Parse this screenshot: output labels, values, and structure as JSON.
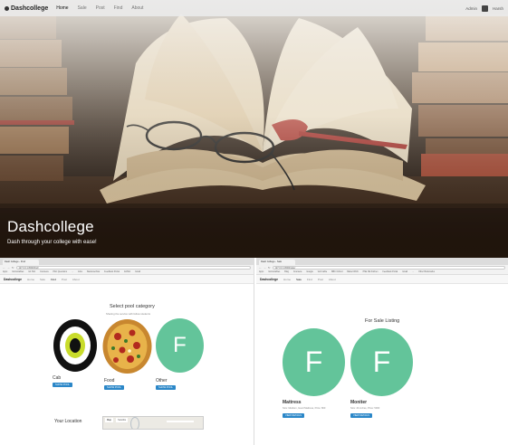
{
  "hero": {
    "brand": "Dashcollege",
    "nav": [
      "Home",
      "Sale",
      "Post",
      "Find",
      "About"
    ],
    "user": {
      "admin_link": "Admin",
      "name": "Harsh"
    },
    "title": "Dashcollege",
    "subtitle": "Dash through your college with ease!"
  },
  "left_panel": {
    "tab_title": "Dash College - Find",
    "url": "127.0.0.1:8000/find/",
    "bookmarks": [
      "Apps",
      "Instructables",
      "Git Hub",
      "Coursera",
      "PAC Questions",
      "...",
      "Jobs",
      "Stackoverflow",
      "Feedback Portal",
      "GitHub",
      "Gmail"
    ],
    "nav_brand": "Dashcollege",
    "nav": [
      "Home",
      "Sale",
      "Find",
      "Post",
      "About"
    ],
    "heading": "Select pool category",
    "subheading": "Sharing the service with fellow students",
    "categories": [
      {
        "label": "Cab",
        "button": "SHOW POOL",
        "icon": "cab-logo-icon"
      },
      {
        "label": "Food",
        "button": "SHOW POOL",
        "icon": "pizza-icon"
      },
      {
        "label": "Other",
        "button": "SHOW POOL",
        "letter": "F"
      }
    ],
    "location_label": "Your Location",
    "map_tabs": [
      "Map",
      "Satellite"
    ]
  },
  "right_panel": {
    "tab_title": "Dash College - Sale",
    "url": "127.0.0.1:8000/sale/",
    "bookmarks": [
      "Apps",
      "Instructables",
      "Blog",
      "Coursera",
      "Google",
      "Verb table",
      "BBC Oxford",
      "Baba CPAN",
      "PSE OE Kitchen",
      "Feedback Portal",
      "Gmail",
      "...",
      "Other Bookmarks"
    ],
    "nav_brand": "Dashcollege",
    "nav": [
      "Home",
      "Sale",
      "Find",
      "Post",
      "About"
    ],
    "heading": "For Sale Listing",
    "listings": [
      {
        "name": "Mattress",
        "letter": "F",
        "details": "Size: Medium, Good Mattress, Price: 800",
        "button": "VIEW DETAILS"
      },
      {
        "name": "Moniter",
        "letter": "F",
        "details": "Size: 24 inches, Price: 5000",
        "button": "VIEW DETAILS"
      }
    ]
  },
  "colors": {
    "accent": "#2b87c8",
    "letter_circle": "#63c49a"
  }
}
